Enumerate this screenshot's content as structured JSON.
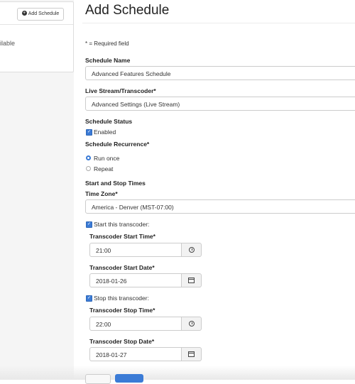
{
  "sidebar": {
    "add_schedule_label": "Add Schedule",
    "partial_text": "ailable"
  },
  "page": {
    "title": "Add Schedule",
    "required_note": "* = Required field"
  },
  "form": {
    "schedule_name": {
      "label": "Schedule Name",
      "value": "Advanced Features Schedule"
    },
    "stream": {
      "label": "Live Stream/Transcoder*",
      "value": "Advanced Settings (Live Stream)"
    },
    "status": {
      "label": "Schedule Status",
      "option": "Enabled",
      "checked": true
    },
    "recurrence": {
      "label": "Schedule Recurrence*",
      "options": [
        "Run once",
        "Repeat"
      ],
      "selected": "Run once"
    },
    "times_header": "Start and Stop Times",
    "timezone": {
      "label": "Time Zone*",
      "value": "America - Denver (MST-07:00)"
    },
    "start": {
      "checkbox": "Start this transcoder:",
      "time_label": "Transcoder Start Time*",
      "time_value": "21:00",
      "date_label": "Transcoder Start Date*",
      "date_value": "2018-01-26"
    },
    "stop": {
      "checkbox": "Stop this transcoder:",
      "time_label": "Transcoder Stop Time*",
      "time_value": "22:00",
      "date_label": "Transcoder Stop Date*",
      "date_value": "2018-01-27"
    }
  },
  "icons": {
    "checkbox": "check-icon",
    "time": "clock-icon",
    "date": "calendar-icon",
    "add": "plus-circle-icon"
  },
  "colors": {
    "accent": "#3b7bd6"
  }
}
